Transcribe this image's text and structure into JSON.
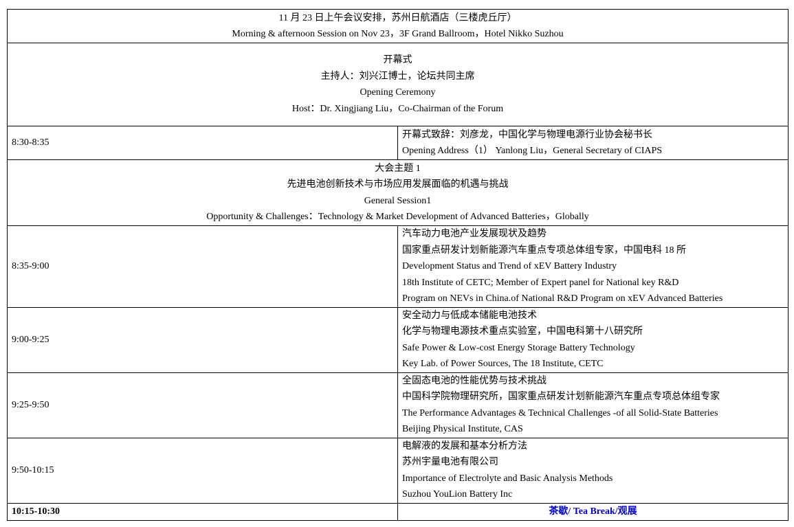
{
  "header": {
    "line_cn": "11 月 23 日上午会议安排，苏州日航酒店（三楼虎丘厅）",
    "line_en": "Morning & afternoon Session on Nov 23，3F Grand Ballroom，Hotel Nikko Suzhou"
  },
  "opening": {
    "title_cn": "开幕式",
    "host_cn": "主持人：刘兴江博士，论坛共同主席",
    "title_en": "Opening Ceremony",
    "host_en": "Host：Dr. Xingjiang Liu，Co-Chairman of the Forum"
  },
  "rows": [
    {
      "time": "8:30-8:35",
      "lines": [
        "开幕式致辞：刘彦龙，中国化学与物理电源行业协会秘书长",
        "Opening Address（1） Yanlong Liu，General Secretary of CIAPS"
      ]
    }
  ],
  "session1": {
    "label_cn": "大会主题 1",
    "title_cn": "先进电池创新技术与市场应用发展面临的机遇与挑战",
    "label_en": "General Session1",
    "title_en": "Opportunity & Challenges：Technology & Market Development of Advanced Batteries，Globally"
  },
  "talks": [
    {
      "time": "8:35-9:00",
      "lines": [
        "汽车动力电池产业发展现状及趋势",
        "国家重点研发计划新能源汽车重点专项总体组专家，中国电科 18 所",
        "Development Status and Trend of xEV Battery Industry",
        "18th Institute of CETC; Member of Expert panel for National key R&D",
        "Program on NEVs in China.of National R&D Program on xEV Advanced Batteries"
      ]
    },
    {
      "time": "9:00-9:25",
      "lines": [
        "安全动力与低成本储能电池技术",
        "化学与物理电源技术重点实验室，中国电科第十八研究所",
        "Safe Power & Low-cost Energy Storage Battery Technology",
        "Key Lab. of Power Sources, The 18 Institute, CETC"
      ]
    },
    {
      "time": "9:25-9:50",
      "lines": [
        "全固态电池的性能优势与技术挑战",
        "中国科学院物理研究所，国家重点研发计划新能源汽车重点专项总体组专家",
        "The Performance Advantages & Technical Challenges -of all Solid-State Batteries",
        "Beijing Physical Institute, CAS"
      ]
    },
    {
      "time": "9:50-10:15",
      "lines": [
        "电解液的发展和基本分析方法",
        "苏州宇量电池有限公司",
        "Importance of Electrolyte and Basic Analysis Methods",
        "Suzhou YouLion Battery Inc"
      ]
    }
  ],
  "break": {
    "time": "10:15-10:30",
    "label": "茶歇/ Tea Break/观展",
    "color": "#0000cc"
  }
}
